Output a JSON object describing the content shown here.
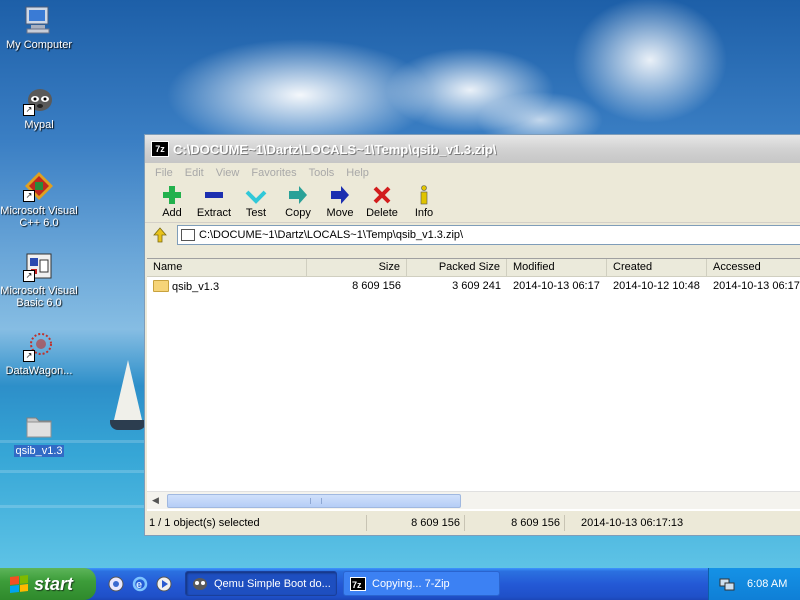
{
  "desktop": {
    "icons": [
      {
        "label": "My Computer",
        "icon": "my-computer-icon"
      },
      {
        "label": "Mypal",
        "icon": "mypal-icon"
      },
      {
        "label": "Microsoft Visual C++ 6.0",
        "icon": "visual-cpp-icon"
      },
      {
        "label": "Microsoft Visual Basic 6.0",
        "icon": "visual-basic-icon"
      },
      {
        "label": "DataWagon...",
        "icon": "datawagon-icon"
      },
      {
        "label": "qsib_v1.3",
        "icon": "folder-icon"
      }
    ]
  },
  "window": {
    "title": "C:\\DOCUME~1\\Dartz\\LOCALS~1\\Temp\\qsib_v1.3.zip\\",
    "app_icon_text": "7z",
    "menu": [
      "File",
      "Edit",
      "View",
      "Favorites",
      "Tools",
      "Help"
    ],
    "toolbar": [
      {
        "label": "Add",
        "icon": "add-icon",
        "color": "#22b14c"
      },
      {
        "label": "Extract",
        "icon": "extract-icon",
        "color": "#1c2fb0"
      },
      {
        "label": "Test",
        "icon": "test-icon",
        "color": "#30c8d8"
      },
      {
        "label": "Copy",
        "icon": "copy-icon",
        "color": "#2aa198"
      },
      {
        "label": "Move",
        "icon": "move-icon",
        "color": "#1c2fb0"
      },
      {
        "label": "Delete",
        "icon": "delete-icon",
        "color": "#d21d1d"
      },
      {
        "label": "Info",
        "icon": "info-icon",
        "color": "#e0c400"
      }
    ],
    "address": "C:\\DOCUME~1\\Dartz\\LOCALS~1\\Temp\\qsib_v1.3.zip\\",
    "columns": [
      "Name",
      "Size",
      "Packed Size",
      "Modified",
      "Created",
      "Accessed"
    ],
    "rows": [
      {
        "name": "qsib_v1.3",
        "size": "8 609 156",
        "packed": "3 609 241",
        "modified": "2014-10-13 06:17",
        "created": "2014-10-12 10:48",
        "accessed": "2014-10-13 06:17"
      }
    ],
    "status": {
      "selection": "1 / 1 object(s) selected",
      "size": "8 609 156",
      "packed": "8 609 156",
      "date": "2014-10-13 06:17:13"
    }
  },
  "taskbar": {
    "start_label": "start",
    "tasks": [
      {
        "label": "Qemu Simple Boot do...",
        "icon": "mypal-icon",
        "active": true
      },
      {
        "label": "Copying... 7-Zip",
        "icon": "7zip-icon",
        "active": false
      }
    ],
    "clock": "6:08 AM"
  }
}
